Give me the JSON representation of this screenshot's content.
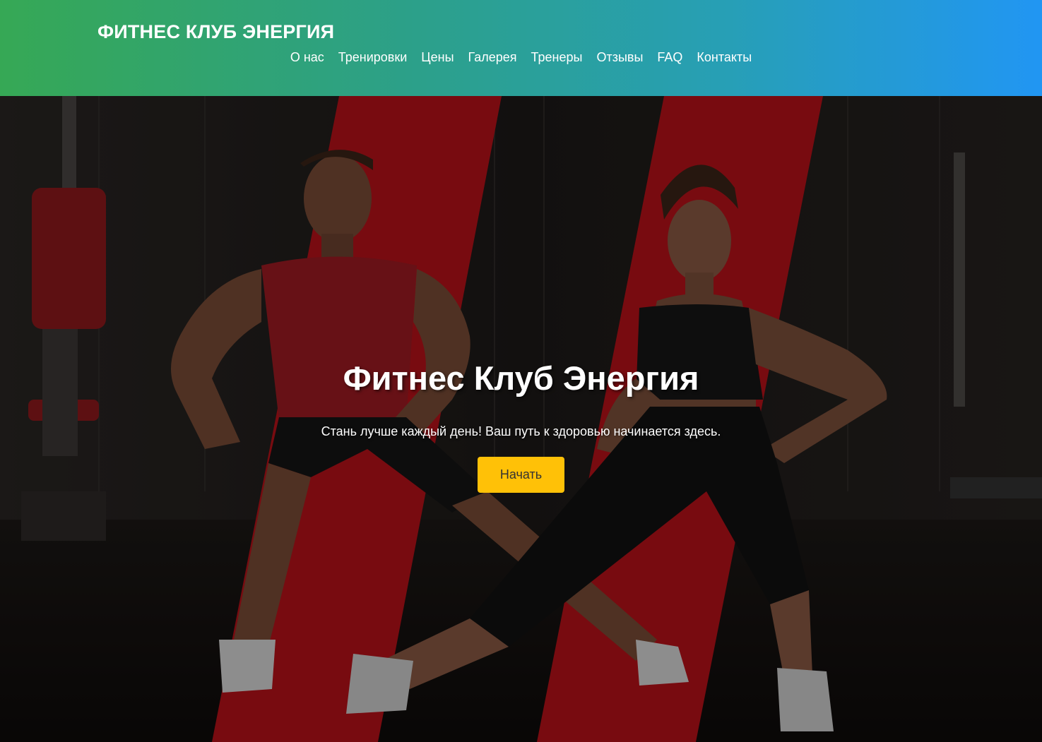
{
  "header": {
    "logo": "ФИТНЕС КЛУБ ЭНЕРГИЯ",
    "nav": [
      {
        "label": "О нас"
      },
      {
        "label": "Тренировки"
      },
      {
        "label": "Цены"
      },
      {
        "label": "Галерея"
      },
      {
        "label": "Тренеры"
      },
      {
        "label": "Отзывы"
      },
      {
        "label": "FAQ"
      },
      {
        "label": "Контакты"
      }
    ]
  },
  "hero": {
    "title": "Фитнес Клуб Энергия",
    "subtitle": "Стань лучше каждый день! Ваш путь к здоровью начинается здесь.",
    "button_label": "Начать",
    "accent_color": "#ffc107",
    "stripe_color": "#c0141a"
  },
  "colors": {
    "header_gradient_start": "#36a855",
    "header_gradient_end": "#2196f3"
  }
}
